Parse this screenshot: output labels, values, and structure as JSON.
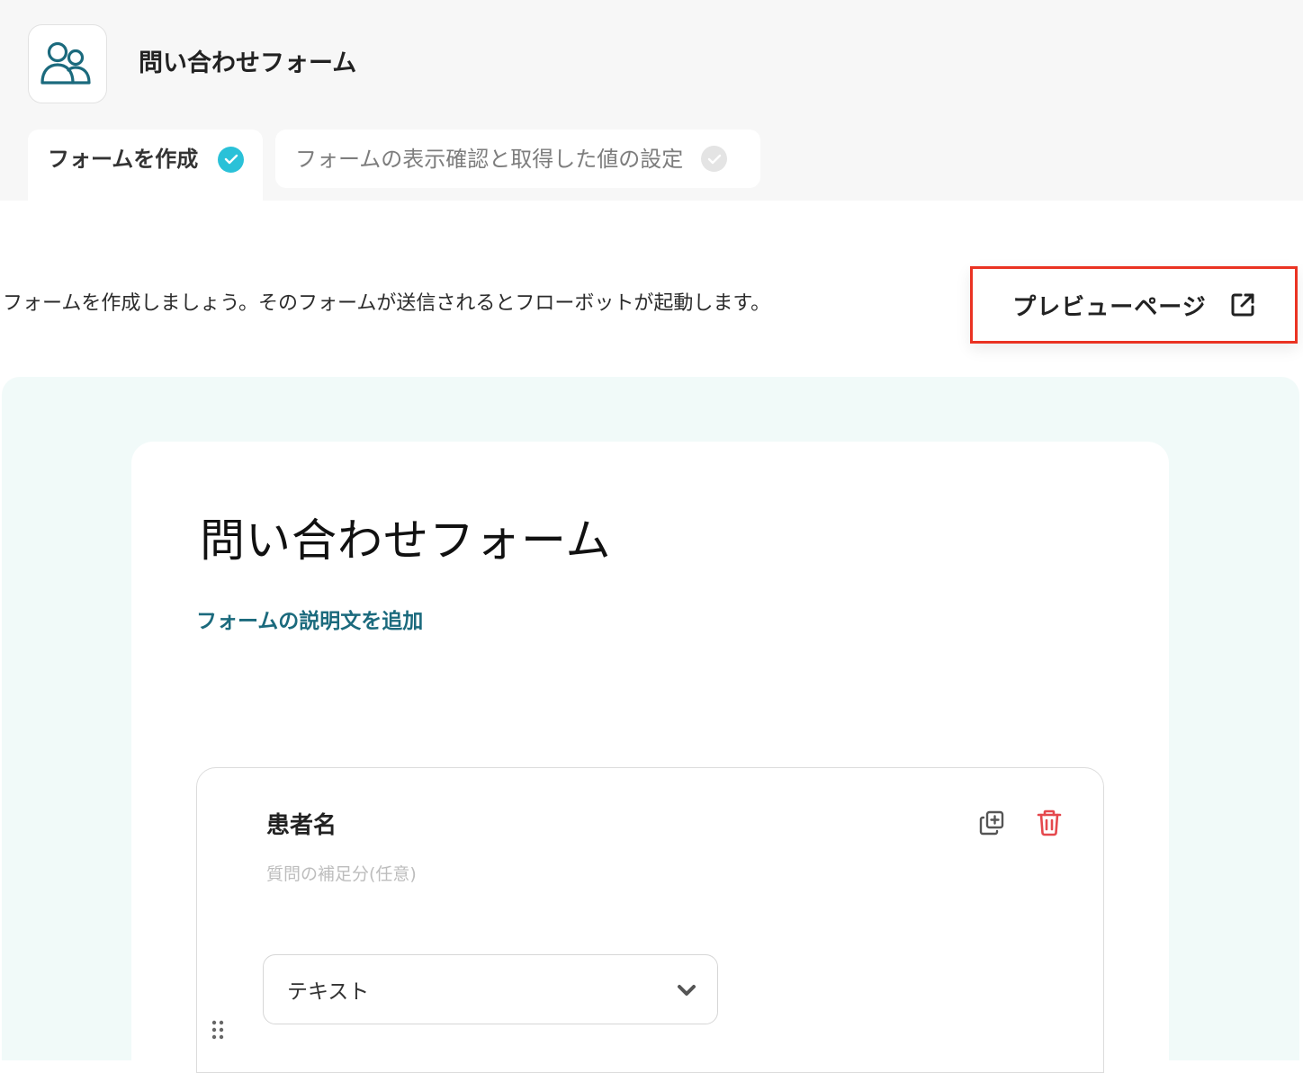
{
  "app": {
    "title": "問い合わせフォーム",
    "icon": "users-icon"
  },
  "tabs": [
    {
      "label": "フォームを作成",
      "status": "completed",
      "check_color": "#2ac1d8"
    },
    {
      "label": "フォームの表示確認と取得した値の設定",
      "status": "pending",
      "check_color": "#e4e4e4"
    }
  ],
  "intro": {
    "text": "フォームを作成しましょう。そのフォームが送信されるとフローボットが起動します。"
  },
  "preview_button": {
    "label": "プレビューページ",
    "icon": "external-link-icon",
    "highlight_color": "#ea3323"
  },
  "form": {
    "title": "問い合わせフォーム",
    "add_description_label": "フォームの説明文を追加",
    "link_color": "#1b6a7d",
    "background_color": "#f1faf9",
    "questions": [
      {
        "title": "患者名",
        "description_placeholder": "質問の補足分(任意)",
        "type_selected": "テキスト",
        "actions": [
          "copy-icon",
          "trash-icon"
        ],
        "delete_color": "#e5484d"
      }
    ]
  }
}
